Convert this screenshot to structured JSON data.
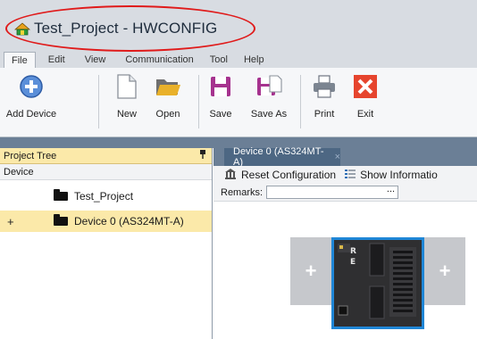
{
  "window": {
    "title": "Test_Project - HWCONFIG"
  },
  "menu": {
    "items": [
      "File",
      "Edit",
      "View",
      "Communication",
      "Tool",
      "Help"
    ]
  },
  "ribbon": {
    "add_device": "Add Device",
    "new": "New",
    "open": "Open",
    "save": "Save",
    "save_as": "Save As",
    "print": "Print",
    "exit": "Exit"
  },
  "project_tree": {
    "header": "Project Tree",
    "pin_icon": "pin-icon",
    "column": "Device",
    "project_name": "Test_Project",
    "expander": "+",
    "device_name": "Device 0 (AS324MT-A)"
  },
  "document": {
    "tab_label": "Device 0 (AS324MT-A)",
    "tab_close": "×",
    "reset_configuration": "Reset Configuration",
    "show_information": "Show Informatio",
    "remarks_label": "Remarks:",
    "remarks_value": "",
    "remarks_browse": "..."
  },
  "rack": {
    "left_slot": "+",
    "right_slot": "+",
    "led_labels": [
      "R",
      "E"
    ]
  },
  "colors": {
    "title_highlight": "#e01b1b",
    "selected_row": "#fbe9a9",
    "device_frame": "#1f86d6",
    "tab_bg": "#4d6783"
  }
}
